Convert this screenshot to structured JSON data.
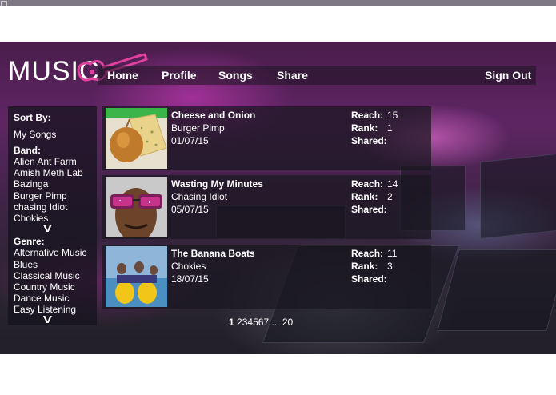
{
  "header": {
    "logo_text": "MUSIC",
    "nav": [
      "Home",
      "Profile",
      "Songs",
      "Share"
    ],
    "sign_out": "Sign Out"
  },
  "sidebar": {
    "sort_label": "Sort  By:",
    "my_songs": "My Songs",
    "band_label": "Band:",
    "bands": [
      "Alien Ant Farm",
      "Amish Meth Lab",
      "Bazinga",
      "Burger Pimp",
      "chasing Idiot",
      "Chokies"
    ],
    "genre_label": "Genre:",
    "genres": [
      "Alternative Music",
      "Blues",
      "Classical Music",
      "Country Music",
      "Dance Music",
      "Easy Listening"
    ],
    "more_glyph": "V"
  },
  "stat_labels": {
    "reach": "Reach:",
    "rank": "Rank:",
    "shared": "Shared:"
  },
  "songs": [
    {
      "title": "Cheese and Onion",
      "band": "Burger Pimp",
      "date": "01/07/15",
      "reach": "15",
      "rank": "1",
      "shared": ""
    },
    {
      "title": "Wasting My Minutes",
      "band": "Chasing Idiot",
      "date": "05/07/15",
      "reach": "14",
      "rank": "2",
      "shared": ""
    },
    {
      "title": "The Banana Boats",
      "band": "Chokies",
      "date": "18/07/15",
      "reach": "11",
      "rank": "3",
      "shared": ""
    }
  ],
  "pagination": {
    "current": "1",
    "pages": [
      "2",
      "3",
      "4",
      "5",
      "6",
      "7"
    ],
    "ellipsis": "...",
    "last": "20"
  },
  "colors": {
    "accent": "#e0409e",
    "text": "#ffffff"
  }
}
